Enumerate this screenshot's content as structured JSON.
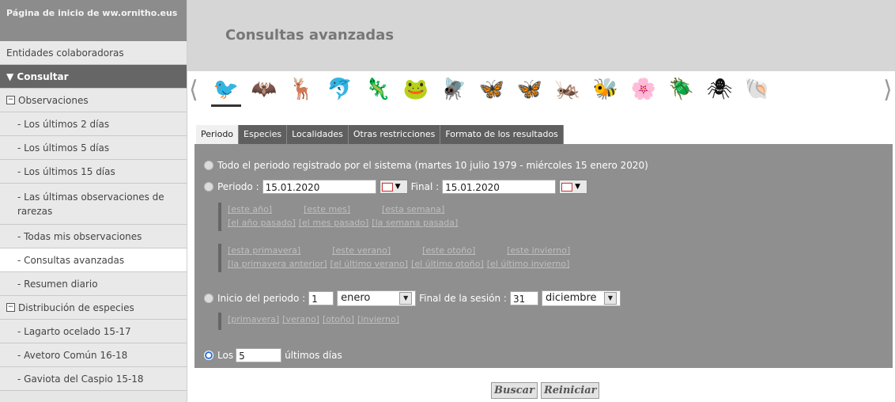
{
  "sidebar": {
    "home": "Página de inicio de ww.ornitho.eus",
    "items": [
      {
        "label": "Entidades colaboradoras",
        "style": "plain"
      },
      {
        "label": "▼ Consultar",
        "style": "dark"
      },
      {
        "label": "Observaciones",
        "style": "group"
      },
      {
        "label": "- Los últimos 2 días",
        "style": "sub"
      },
      {
        "label": "- Los últimos 5 días",
        "style": "sub"
      },
      {
        "label": "- Los últimos 15 días",
        "style": "sub"
      },
      {
        "label": "- Las últimas observaciones de rarezas",
        "style": "subtall"
      },
      {
        "label": "- Todas mis observaciones",
        "style": "sub"
      },
      {
        "label": "- Consultas avanzadas",
        "style": "subwhite"
      },
      {
        "label": "- Resumen diario",
        "style": "sub"
      },
      {
        "label": "Distribución de especies",
        "style": "group"
      },
      {
        "label": "- Lagarto ocelado 15-17",
        "style": "sub"
      },
      {
        "label": "- Avetoro Común 16-18",
        "style": "sub"
      },
      {
        "label": "- Gaviota del Caspio 15-18",
        "style": "sub"
      }
    ]
  },
  "header": {
    "title": "Consultas avanzadas"
  },
  "taxa_icons": [
    "bird-icon",
    "bat-icon",
    "deer-icon",
    "dolphin-icon",
    "lizard-icon",
    "frog-icon",
    "dragonfly-icon",
    "butterfly-icon",
    "moth-icon",
    "grasshopper-icon",
    "bee-icon",
    "orchid-icon",
    "beetle-icon",
    "spider-icon",
    "shell-icon"
  ],
  "taxa_glyphs": [
    "🐦",
    "🦇",
    "🦌",
    "🐬",
    "🦎",
    "🐸",
    "🪰",
    "🦋",
    "🦋",
    "🦗",
    "🐝",
    "🌸",
    "🪲",
    "🕷",
    "🐚"
  ],
  "arrows": {
    "left": "⟨",
    "right": "⟩"
  },
  "tabs": [
    "Periodo",
    "Especies",
    "Localidades",
    "Otras restricciones",
    "Formato de los resultados"
  ],
  "period": {
    "all_label": "Todo el periodo registrado por el sistema (martes 10 julio 1979 - miércoles 15 enero 2020)",
    "periodo_label": "Periodo :",
    "start_date": "15.01.2020",
    "final_label": "Final :",
    "end_date": "15.01.2020",
    "links_row1": [
      "[este año]",
      "[este mes]",
      "[esta semana]"
    ],
    "links_row2": [
      "[el año pasado]",
      "[el mes pasado]",
      "[la semana pasada]"
    ],
    "links_row3": [
      "[esta primavera]",
      "[este verano]",
      "[este otoño]",
      "[este invierno]"
    ],
    "links_row4": [
      "[la primavera anterior]",
      "[el último verano]",
      "[el último otoño]",
      "[el último invierno]"
    ],
    "season_start_label": "Inicio del periodo :",
    "season_start_day": "1",
    "season_start_month": "enero",
    "season_end_label": "Final de la sesión :",
    "season_end_day": "31",
    "season_end_month": "diciembre",
    "season_links": [
      "[primavera]",
      "[verano]",
      "[otoño]",
      "[invierno]"
    ],
    "last_label_prefix": "Los",
    "last_days": "5",
    "last_label_suffix": "últimos días"
  },
  "buttons": {
    "search": "Buscar",
    "reset": "Reiniciar"
  },
  "colors": {
    "header_bg": "#d6d6d6",
    "panel_bg": "#8f8f8f",
    "tab_bg": "#5f5f5f",
    "sidebar_active": "#666666"
  }
}
